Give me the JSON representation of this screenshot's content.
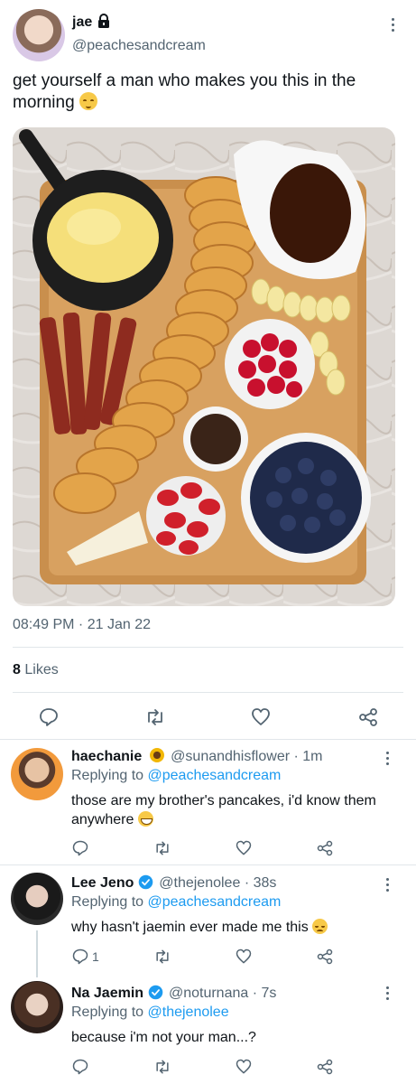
{
  "tweet": {
    "name": "jae",
    "lock_icon": "lock-icon",
    "handle": "@peachesandcream",
    "text": "get yourself a man who makes you this in the morning",
    "emoji": "relieved-face-emoji",
    "timestamp": "08:49 PM · 21 Jan 22",
    "likes_count": "8",
    "likes_label": "Likes",
    "actions": [
      "reply-icon",
      "retweet-icon",
      "like-icon",
      "share-icon"
    ]
  },
  "replies": [
    {
      "name": "haechanie",
      "name_emoji": "sunflower-emoji",
      "handle": "@sunandhisflower",
      "time": "· 1m",
      "replying_prefix": "Replying to",
      "replying_to": "@peachesandcream",
      "text": "those are my brother's pancakes, i'd know them anywhere",
      "emoji": "grinning-face-emoji",
      "reply_count": ""
    },
    {
      "name": "Lee Jeno",
      "verified": true,
      "handle": "@thejenolee",
      "time": "· 38s",
      "replying_prefix": "Replying to",
      "replying_to": "@peachesandcream",
      "text": "why hasn't jaemin ever made me this",
      "emoji": "pensive-face-emoji",
      "reply_count": "1"
    },
    {
      "name": "Na Jaemin",
      "verified": true,
      "handle": "@noturnana",
      "time": "· 7s",
      "replying_prefix": "Replying to",
      "replying_to": "@thejenolee",
      "text": "because i'm not your man...?",
      "reply_count": ""
    }
  ],
  "colors": {
    "accent": "#1d9bf0",
    "text": "#0f1419",
    "muted": "#536471",
    "divider": "#e1e6ea"
  }
}
